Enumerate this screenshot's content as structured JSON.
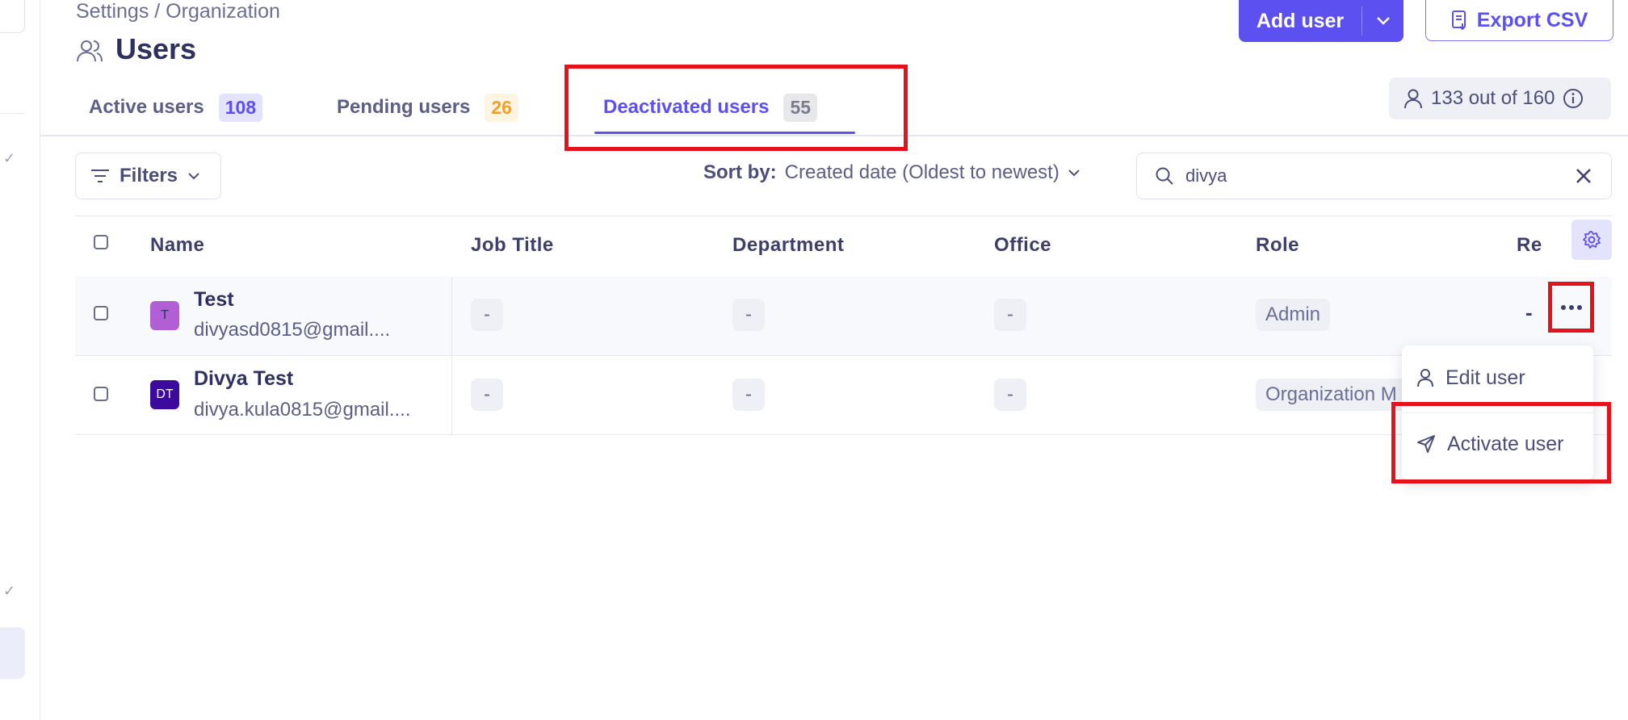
{
  "breadcrumb": "Settings / Organization",
  "page_title": "Users",
  "header": {
    "add_user_label": "Add user",
    "export_label": "Export CSV"
  },
  "tabs": [
    {
      "label": "Active users",
      "count": "108"
    },
    {
      "label": "Pending users",
      "count": "26"
    },
    {
      "label": "Deactivated users",
      "count": "55"
    }
  ],
  "seats": "133 out of 160",
  "toolbar": {
    "filters_label": "Filters",
    "sort_label": "Sort by:",
    "sort_value": "Created date (Oldest to newest)",
    "search_value": "divya"
  },
  "table": {
    "headers": [
      "Name",
      "Job Title",
      "Department",
      "Office",
      "Role",
      "Re"
    ],
    "rows": [
      {
        "initials": "T",
        "name": "Test",
        "email": "divyasd0815@gmail....",
        "job": "-",
        "dept": "-",
        "office": "-",
        "role": "Admin",
        "re": "-"
      },
      {
        "initials": "DT",
        "name": "Divya Test",
        "email": "divya.kula0815@gmail....",
        "job": "-",
        "dept": "-",
        "office": "-",
        "role": "Organization M"
      }
    ]
  },
  "row_menu": {
    "edit": "Edit user",
    "activate": "Activate user"
  },
  "colors": {
    "accent": "#5c50f0",
    "highlight": "#e6121b",
    "active_badge": "#e3e3fb",
    "pending_badge": "#fdf4e3"
  }
}
